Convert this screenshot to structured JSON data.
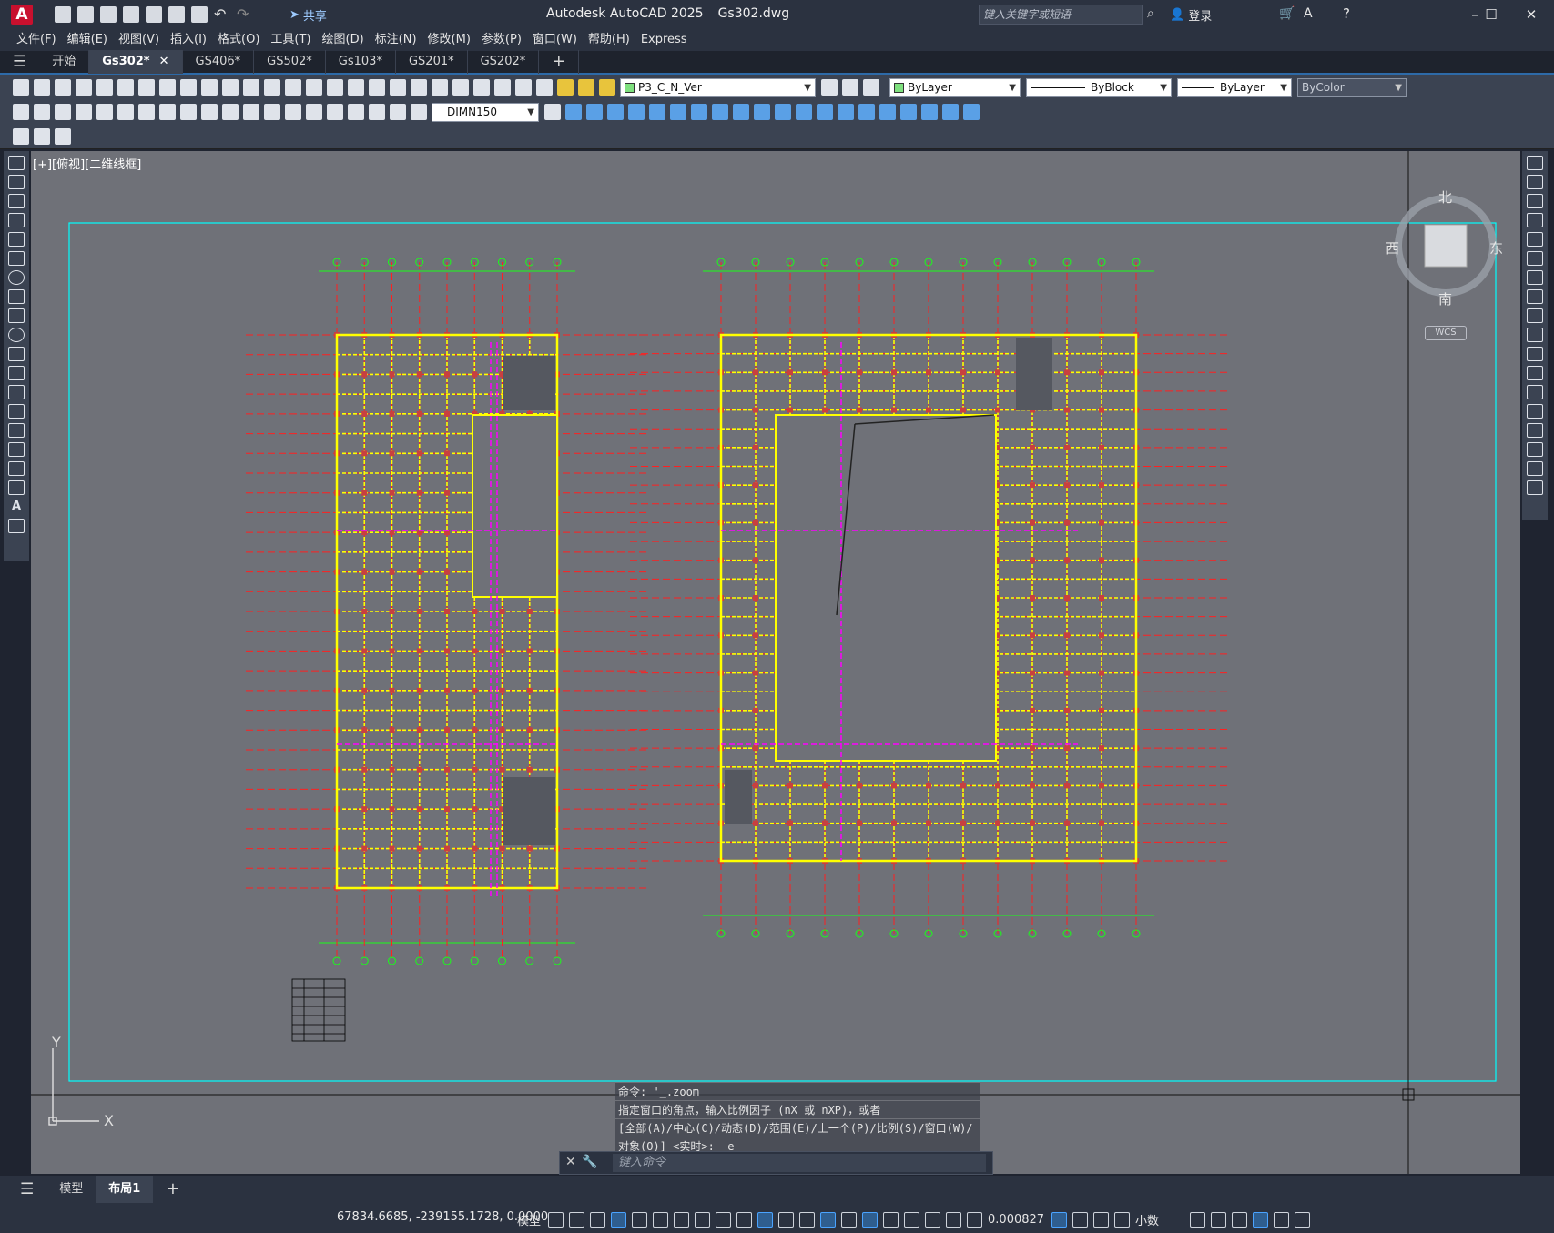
{
  "app": {
    "title": "Autodesk AutoCAD 2025",
    "file": "Gs302.dwg",
    "logo": "A",
    "share_label": "共享",
    "login_label": "登录",
    "search_placeholder": "键入关键字或短语"
  },
  "menu": [
    "文件(F)",
    "编辑(E)",
    "视图(V)",
    "插入(I)",
    "格式(O)",
    "工具(T)",
    "绘图(D)",
    "标注(N)",
    "修改(M)",
    "参数(P)",
    "窗口(W)",
    "帮助(H)",
    "Express"
  ],
  "tabs": [
    {
      "label": "开始",
      "active": false
    },
    {
      "label": "Gs302*",
      "active": true
    },
    {
      "label": "GS406*",
      "active": false
    },
    {
      "label": "GS502*",
      "active": false
    },
    {
      "label": "Gs103*",
      "active": false
    },
    {
      "label": "GS201*",
      "active": false
    },
    {
      "label": "GS202*",
      "active": false
    }
  ],
  "toolbar": {
    "layer": "P3_C_N_Ver",
    "color": "ByLayer",
    "linetype": "ByBlock",
    "lineweight": "ByLayer",
    "plotstyle": "ByColor",
    "dimstyle": "DIMN150"
  },
  "viewport": {
    "label": "[+][俯视][二维线框]",
    "compass": {
      "north": "北",
      "south": "南",
      "east": "东",
      "west": "西"
    },
    "wcs": "WCS",
    "ucs_x": "X",
    "ucs_y": "Y"
  },
  "command": {
    "history": [
      "命令: '_.zoom",
      "指定窗口的角点，输入比例因子 (nX 或 nXP)，或者",
      "[全部(A)/中心(C)/动态(D)/范围(E)/上一个(P)/比例(S)/窗口(W)/",
      "对象(O)] <实时>: _e"
    ],
    "placeholder": "键入命令"
  },
  "layout_tabs": [
    {
      "label": "模型",
      "active": false
    },
    {
      "label": "布局1",
      "active": true
    }
  ],
  "status": {
    "coords": "67834.6685, -239155.1728, 0.0000",
    "space": "模型",
    "scale": "0.000827",
    "units": "小数"
  },
  "colors": {
    "canvas": "#6f7178",
    "grid_red": "#ff2020",
    "grid_green": "#18ff18",
    "wall_yellow": "#ffff00",
    "magenta": "#ff00ff",
    "cyan": "#00ffff"
  }
}
